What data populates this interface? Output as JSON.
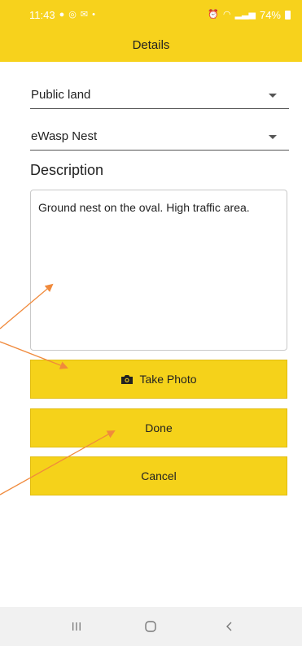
{
  "status_bar": {
    "time": "11:43",
    "battery": "74%",
    "text_color": "#ffffff",
    "left_icons": [
      "facebook-icon",
      "instagram-icon",
      "mail-icon",
      "dot-icon"
    ],
    "right_icons": [
      "alarm-icon",
      "wifi-icon",
      "signal-icon",
      "battery-icon"
    ]
  },
  "app_bar": {
    "title": "Details",
    "color": "#f7d21c"
  },
  "form": {
    "land_select": {
      "value": "Public land"
    },
    "type_select": {
      "value": "eWasp Nest"
    },
    "description_label": "Description",
    "description_text": "Ground nest on the oval. High traffic area."
  },
  "buttons": {
    "take_photo": {
      "label": "Take Photo",
      "icon": "camera-icon"
    },
    "done": {
      "label": "Done"
    },
    "cancel": {
      "label": "Cancel"
    },
    "color": "#f5d21a"
  },
  "annotations": {
    "arrow_color": "#f08a3c",
    "count": 3
  },
  "nav_bar": {
    "icons": [
      "recent-apps-icon",
      "home-icon",
      "back-icon"
    ]
  }
}
